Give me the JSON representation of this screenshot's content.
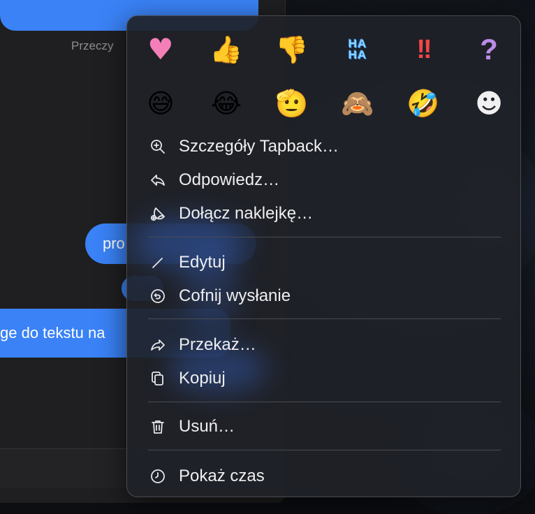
{
  "messages": {
    "read_receipt": "Przeczy",
    "bubble_middle_text": "pro",
    "bubble_bottom_text": "ge do tekstu na"
  },
  "tapbacks": {
    "row1": [
      {
        "name": "heart-icon",
        "glyph": "♥"
      },
      {
        "name": "thumbs-up-icon",
        "glyph": "👍"
      },
      {
        "name": "thumbs-down-icon",
        "glyph": "👎"
      },
      {
        "name": "haha-icon",
        "glyph": "HA\nHA"
      },
      {
        "name": "double-exclamation-icon",
        "glyph": "!!"
      },
      {
        "name": "question-mark-icon",
        "glyph": "?"
      }
    ],
    "row2": [
      {
        "name": "grinning-sweat-emoji-icon",
        "glyph": "😅"
      },
      {
        "name": "tears-of-joy-emoji-icon",
        "glyph": "😂"
      },
      {
        "name": "saluting-face-emoji-icon",
        "glyph": "🫡"
      },
      {
        "name": "see-no-evil-emoji-icon",
        "glyph": "🙈"
      },
      {
        "name": "rolling-laughing-emoji-icon",
        "glyph": "🤣"
      },
      {
        "name": "add-emoji-icon",
        "glyph": "☻"
      }
    ]
  },
  "menu": {
    "tapback_details": "Szczegóły Tapback…",
    "reply": "Odpowiedz…",
    "attach_sticker": "Dołącz naklejkę…",
    "edit": "Edytuj",
    "undo_send": "Cofnij wysłanie",
    "forward": "Przekaż…",
    "copy": "Kopiuj",
    "delete": "Usuń…",
    "show_time": "Pokaż czas"
  },
  "colors": {
    "bubble_blue": "#3a82f6",
    "menu_background": "#202228",
    "menu_text": "#eeeeef",
    "separator": "#4a4b50"
  }
}
